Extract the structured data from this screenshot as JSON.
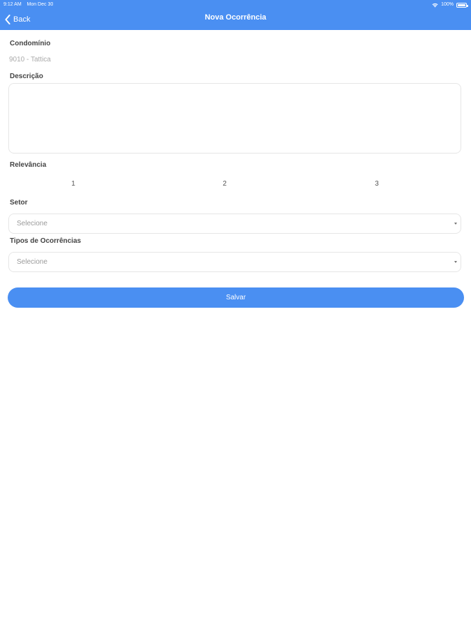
{
  "status_bar": {
    "time": "9:12 AM",
    "date": "Mon Dec 30",
    "battery": "100%",
    "icons": [
      "wifi-icon",
      "battery-icon"
    ]
  },
  "nav": {
    "back_label": "Back",
    "title": "Nova Ocorrência",
    "back_icon": "chevron-left-icon"
  },
  "form": {
    "condominio": {
      "label": "Condomínio",
      "value": "9010 - Tattica"
    },
    "descricao": {
      "label": "Descrição",
      "value": ""
    },
    "relevancia": {
      "label": "Relevância",
      "options": [
        "1",
        "2",
        "3"
      ]
    },
    "setor": {
      "label": "Setor",
      "selected": "Selecione"
    },
    "tipos": {
      "label": "Tipos de Ocorrências",
      "selected": "Selecione"
    }
  },
  "actions": {
    "save_label": "Salvar"
  },
  "colors": {
    "accent": "#4a8ff2",
    "background": "#ffffff",
    "label": "#444444",
    "placeholder": "#9a9a9a"
  }
}
